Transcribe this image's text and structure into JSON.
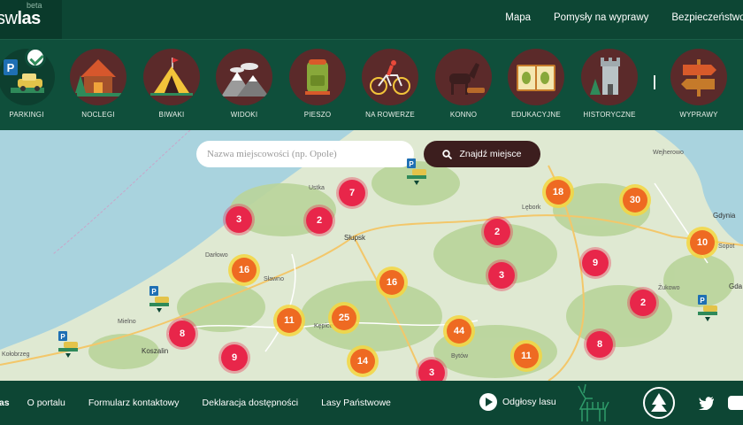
{
  "header": {
    "logo_prefix": "sw",
    "logo_bold": "las",
    "beta": "beta",
    "nav": [
      "Mapa",
      "Pomysły na wyprawy",
      "Bezpieczeństwo w"
    ]
  },
  "categories": [
    {
      "label": "PARKINGI",
      "icon": "parking-icon",
      "active": true
    },
    {
      "label": "NOCLEGI",
      "icon": "cabin-icon"
    },
    {
      "label": "BIWAKI",
      "icon": "tent-icon"
    },
    {
      "label": "WIDOKI",
      "icon": "mountains-icon"
    },
    {
      "label": "PIESZO",
      "icon": "backpack-icon"
    },
    {
      "label": "NA ROWERZE",
      "icon": "bicycle-icon"
    },
    {
      "label": "KONNO",
      "icon": "horse-icon"
    },
    {
      "label": "EDUKACYJNE",
      "icon": "book-icon"
    },
    {
      "label": "HISTORYCZNE",
      "icon": "tower-icon"
    },
    {
      "label": "WYPRAWY",
      "icon": "signpost-icon"
    }
  ],
  "search": {
    "placeholder": "Nazwa miejscowości (np. Opole)",
    "button": "Znajdź miejsce"
  },
  "map": {
    "clusters": [
      {
        "value": "7",
        "style": "red"
      },
      {
        "value": "3",
        "style": "red"
      },
      {
        "value": "2",
        "style": "red"
      },
      {
        "value": "18",
        "style": "orange"
      },
      {
        "value": "30",
        "style": "orange"
      },
      {
        "value": "2",
        "style": "red"
      },
      {
        "value": "10",
        "style": "orange"
      },
      {
        "value": "16",
        "style": "orange"
      },
      {
        "value": "9",
        "style": "red"
      },
      {
        "value": "3",
        "style": "red"
      },
      {
        "value": "16",
        "style": "orange"
      },
      {
        "value": "2",
        "style": "red"
      },
      {
        "value": "11",
        "style": "orange"
      },
      {
        "value": "25",
        "style": "orange"
      },
      {
        "value": "8",
        "style": "red"
      },
      {
        "value": "44",
        "style": "orange"
      },
      {
        "value": "8",
        "style": "red"
      },
      {
        "value": "9",
        "style": "red"
      },
      {
        "value": "14",
        "style": "orange"
      },
      {
        "value": "11",
        "style": "orange"
      },
      {
        "value": "3",
        "style": "red"
      }
    ],
    "towns": [
      "Ustka",
      "Słupsk",
      "Lębork",
      "Wejherowo",
      "Gdynia",
      "Sopot",
      "Gda",
      "Darłowo",
      "Sławno",
      "Żukowo",
      "Mielno",
      "Koszalin",
      "Kępice",
      "Bytów",
      "Kołobrzeg"
    ]
  },
  "footer": {
    "links": [
      "las",
      "O portalu",
      "Formularz kontaktowy",
      "Deklaracja dostępności",
      "Lasy Państwowe"
    ],
    "sounds": "Odgłosy lasu"
  },
  "colors": {
    "header": "#0d4634",
    "categories": "#0f4f3b",
    "cluster_red": "#e8264a",
    "cluster_orange": "#ee6a22"
  }
}
